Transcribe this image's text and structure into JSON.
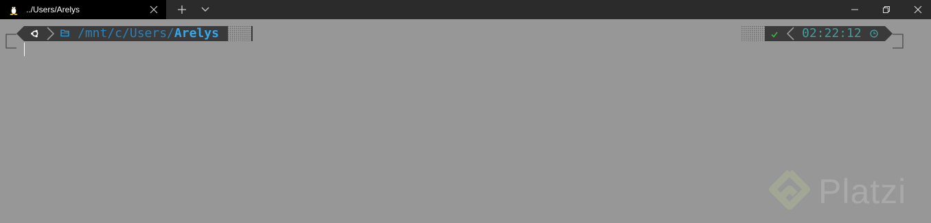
{
  "tab": {
    "title": "../Users/Arelys",
    "icon": "linux-penguin-icon"
  },
  "window_controls": [
    "minimize-icon",
    "maximize-icon",
    "close-icon"
  ],
  "prompt": {
    "os_icon": "ubuntu-icon",
    "folder_icon": "folder-icon",
    "path_prefix": "/mnt/c/Users/",
    "path_current": "Arelys",
    "status_icon": "check-icon",
    "time": "02:22:12",
    "clock_icon": "clock-icon"
  },
  "watermark": {
    "text": "Platzi"
  },
  "colors": {
    "titlebar": "#2b2b2b",
    "active_tab": "#000000",
    "terminal_bg": "#979797",
    "segment_bg": "#3a3a3a",
    "path": "#2b9fe0",
    "time": "#4a9a9a",
    "status_ok": "#3fae3f"
  }
}
